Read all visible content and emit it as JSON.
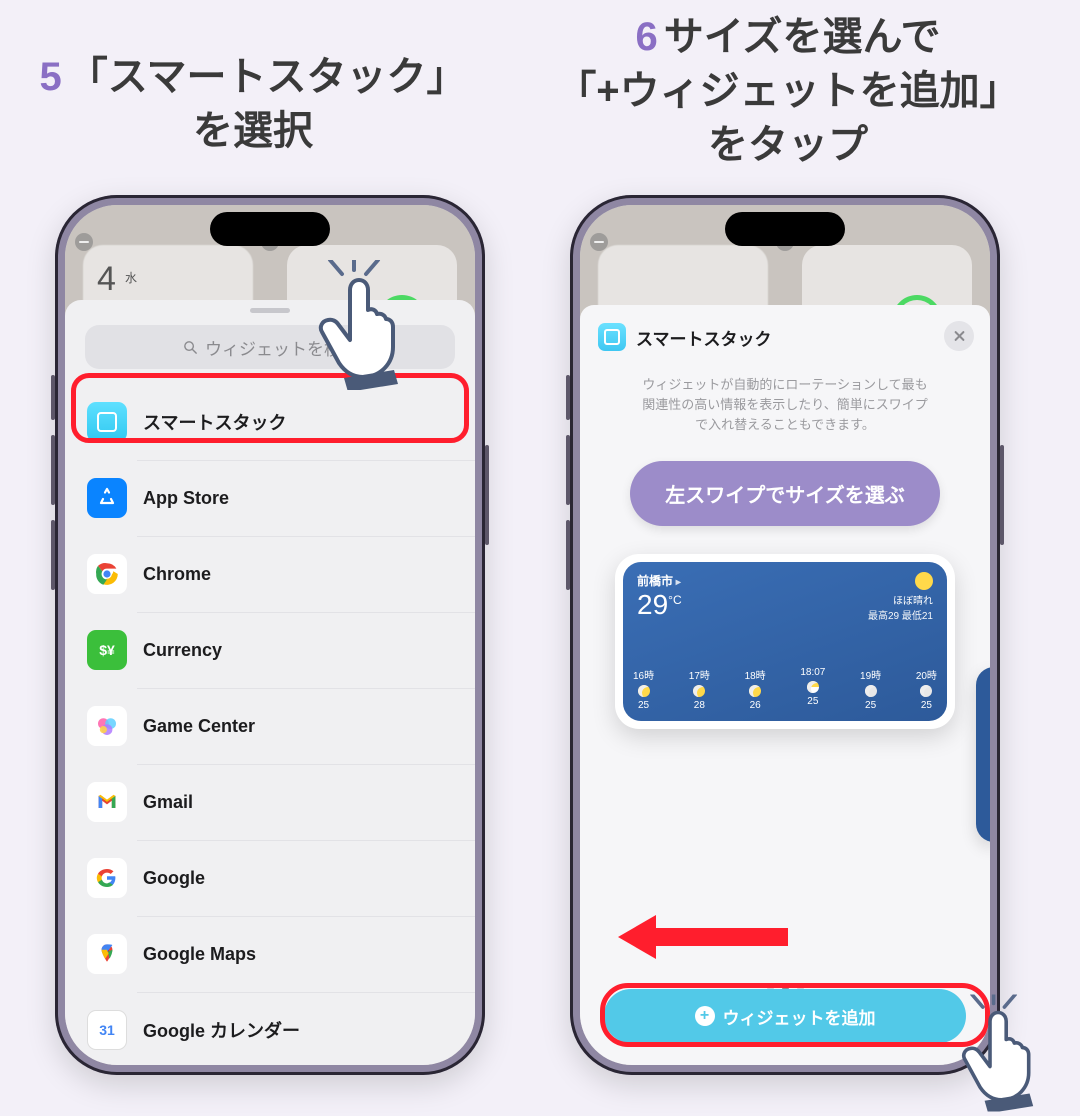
{
  "step5": {
    "num": "5",
    "title_l1": "「スマートスタック」",
    "title_l2": "を選択"
  },
  "step6": {
    "num": "6",
    "title_l1": "サイズを選んで",
    "title_l2": "「+ウィジェットを追加」",
    "title_l3": "をタップ"
  },
  "left": {
    "bg_day_num": "4",
    "bg_day_label": "水",
    "search_placeholder": "ウィジェットを検索",
    "apps": [
      {
        "key": "smartstack",
        "label": "スマートスタック"
      },
      {
        "key": "appstore",
        "label": "App Store"
      },
      {
        "key": "chrome",
        "label": "Chrome"
      },
      {
        "key": "currency",
        "label": "Currency"
      },
      {
        "key": "gamecenter",
        "label": "Game Center"
      },
      {
        "key": "gmail",
        "label": "Gmail"
      },
      {
        "key": "google",
        "label": "Google"
      },
      {
        "key": "gmaps",
        "label": "Google Maps"
      },
      {
        "key": "gcal",
        "label": "Google カレンダー"
      }
    ]
  },
  "right": {
    "title": "スマートスタック",
    "desc_l1": "ウィジェットが自動的にローテーションして最も",
    "desc_l2": "関連性の高い情報を表示したり、簡単にスワイプ",
    "desc_l3": "で入れ替えることもできます。",
    "bubble": "左スワイプでサイズを選ぶ",
    "weather": {
      "city": "前橋市",
      "temp": "29",
      "temp_unit": "°C",
      "condition": "ほぼ晴れ",
      "high_label": "最高",
      "high": "29",
      "low_label": "最低",
      "low": "21",
      "hours": [
        {
          "h": "16時",
          "t": "25"
        },
        {
          "h": "17時",
          "t": "28"
        },
        {
          "h": "18時",
          "t": "26"
        },
        {
          "h": "18:07",
          "t": "25"
        },
        {
          "h": "19時",
          "t": "25"
        },
        {
          "h": "20時",
          "t": "25"
        }
      ]
    },
    "add_button": "ウィジェットを追加",
    "cal_day": "31"
  }
}
